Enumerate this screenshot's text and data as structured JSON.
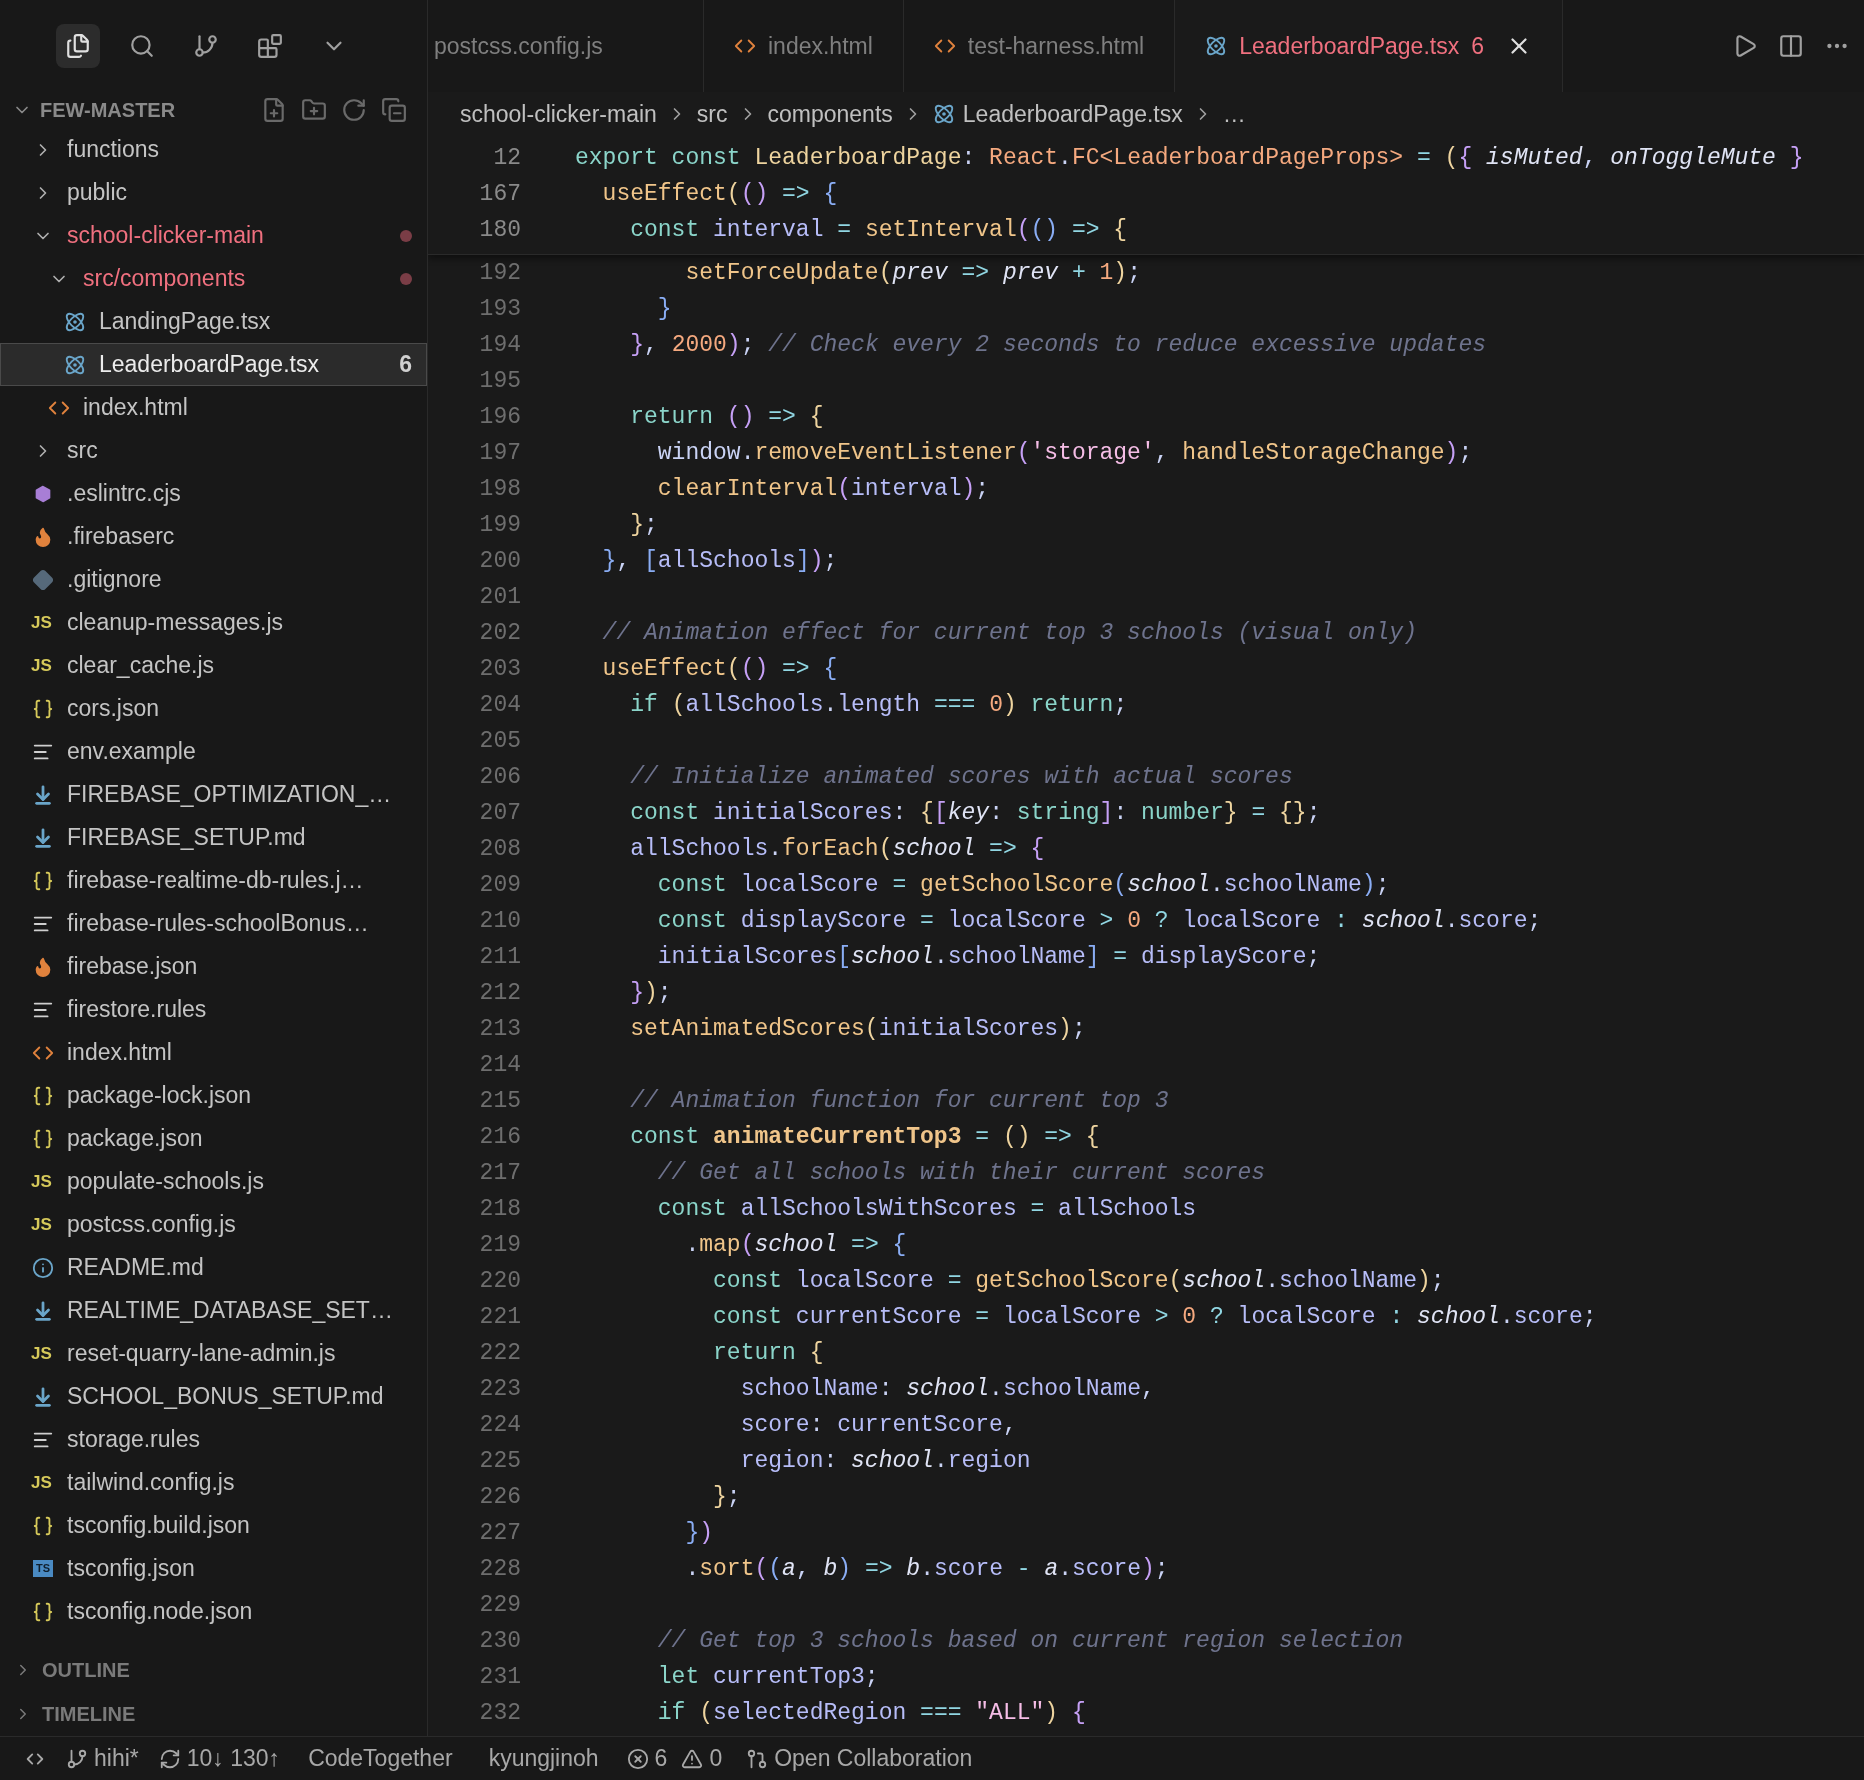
{
  "activity_bar": [
    {
      "kind": "explorer",
      "selected": true
    },
    {
      "kind": "search",
      "selected": false
    },
    {
      "kind": "source-control",
      "selected": false
    },
    {
      "kind": "extensions",
      "selected": false
    },
    {
      "kind": "more",
      "selected": false
    }
  ],
  "tabs": [
    {
      "label": "postcss.config.js",
      "selected": false
    },
    {
      "label": "index.html",
      "kind": "html",
      "selected": false
    },
    {
      "label": "test-harness.html",
      "kind": "html",
      "selected": false
    },
    {
      "label": "LeaderboardPage.tsx",
      "kind": "react",
      "selected": true,
      "badge": "6",
      "errors": true
    }
  ],
  "explorer": {
    "title": "FEW-MASTER",
    "expanded": true,
    "items": [
      {
        "label": "functions",
        "kind": "folder",
        "expanded": false
      },
      {
        "label": "public",
        "kind": "folder",
        "expanded": false
      },
      {
        "label": "school-clicker-main",
        "kind": "folder",
        "expanded": true,
        "modified": true,
        "children": [
          {
            "label": "src/components",
            "kind": "folder",
            "expanded": true,
            "modified": true,
            "children": [
              {
                "label": "LandingPage.tsx",
                "kind": "react",
                "selected": false
              },
              {
                "label": "LeaderboardPage.tsx",
                "kind": "react",
                "selected": true,
                "badge": "6"
              }
            ]
          },
          {
            "label": "index.html",
            "kind": "html",
            "selected": false
          }
        ]
      },
      {
        "label": "src",
        "kind": "folder",
        "expanded": false
      },
      {
        "label": ".eslintrc.cjs",
        "kind": "eslint",
        "selected": false
      },
      {
        "label": ".firebaserc",
        "kind": "firebase",
        "selected": false
      },
      {
        "label": ".gitignore",
        "kind": "git",
        "selected": false
      },
      {
        "label": "cleanup-messages.js",
        "kind": "js",
        "icon_label": "JS",
        "selected": false
      },
      {
        "label": "clear_cache.js",
        "kind": "js",
        "icon_label": "JS",
        "selected": false
      },
      {
        "label": "cors.json",
        "kind": "json",
        "selected": false
      },
      {
        "label": "env.example",
        "kind": "text",
        "selected": false
      },
      {
        "label": "FIREBASE_OPTIMIZATION_…",
        "kind": "markdown",
        "selected": false
      },
      {
        "label": "FIREBASE_SETUP.md",
        "kind": "markdown",
        "selected": false
      },
      {
        "label": "firebase-realtime-db-rules.j…",
        "kind": "json",
        "selected": false
      },
      {
        "label": "firebase-rules-schoolBonus…",
        "kind": "text",
        "selected": false
      },
      {
        "label": "firebase.json",
        "kind": "firebase",
        "selected": false
      },
      {
        "label": "firestore.rules",
        "kind": "text",
        "selected": false
      },
      {
        "label": "index.html",
        "kind": "html",
        "selected": false
      },
      {
        "label": "package-lock.json",
        "kind": "json",
        "selected": false
      },
      {
        "label": "package.json",
        "kind": "json",
        "selected": false
      },
      {
        "label": "populate-schools.js",
        "kind": "js",
        "icon_label": "JS",
        "selected": false
      },
      {
        "label": "postcss.config.js",
        "kind": "js",
        "icon_label": "JS",
        "selected": false
      },
      {
        "label": "README.md",
        "kind": "info",
        "selected": false
      },
      {
        "label": "REALTIME_DATABASE_SET…",
        "kind": "markdown",
        "selected": false
      },
      {
        "label": "reset-quarry-lane-admin.js",
        "kind": "js",
        "icon_label": "JS",
        "selected": false
      },
      {
        "label": "SCHOOL_BONUS_SETUP.md",
        "kind": "markdown",
        "selected": false
      },
      {
        "label": "storage.rules",
        "kind": "text",
        "selected": false
      },
      {
        "label": "tailwind.config.js",
        "kind": "js",
        "icon_label": "JS",
        "selected": false
      },
      {
        "label": "tsconfig.build.json",
        "kind": "json",
        "selected": false
      },
      {
        "label": "tsconfig.json",
        "kind": "ts",
        "icon_label": "TS",
        "selected": false
      },
      {
        "label": "tsconfig.node.json",
        "kind": "json",
        "selected": false
      }
    ]
  },
  "panels": [
    {
      "label": "OUTLINE",
      "expanded": false
    },
    {
      "label": "TIMELINE",
      "expanded": false
    }
  ],
  "breadcrumb": [
    {
      "label": "school-clicker-main"
    },
    {
      "label": "src"
    },
    {
      "label": "components"
    },
    {
      "label": "LeaderboardPage.tsx",
      "kind": "react"
    },
    {
      "label": "…"
    }
  ],
  "sticky_lines": [
    {
      "number": "12",
      "tokens": [
        {
          "kind": "kw",
          "text": "export const "
        },
        {
          "kind": "type",
          "text": "LeaderboardPage"
        },
        {
          "kind": "plain",
          "text": ": "
        },
        {
          "kind": "type2",
          "text": "React"
        },
        {
          "kind": "plain",
          "text": "."
        },
        {
          "kind": "type2",
          "text": "FC<LeaderboardPageProps>"
        },
        {
          "kind": "op",
          "text": " = "
        },
        {
          "kind": "b1",
          "text": "("
        },
        {
          "kind": "b2",
          "text": "{ "
        },
        {
          "kind": "param",
          "text": "isMuted"
        },
        {
          "kind": "plain",
          "text": ", "
        },
        {
          "kind": "param",
          "text": "onToggleMute"
        },
        {
          "kind": "b2",
          "text": " }"
        }
      ]
    },
    {
      "number": "167",
      "tokens": [
        {
          "kind": "fn",
          "text": "  useEffect"
        },
        {
          "kind": "b1",
          "text": "("
        },
        {
          "kind": "b2",
          "text": "()"
        },
        {
          "kind": "op",
          "text": " => "
        },
        {
          "kind": "b3",
          "text": "{"
        }
      ]
    },
    {
      "number": "180",
      "tokens": [
        {
          "kind": "kw",
          "text": "    const "
        },
        {
          "kind": "var",
          "text": "interval"
        },
        {
          "kind": "op",
          "text": " = "
        },
        {
          "kind": "fn",
          "text": "setInterval"
        },
        {
          "kind": "b2",
          "text": "("
        },
        {
          "kind": "b3",
          "text": "()"
        },
        {
          "kind": "op",
          "text": " => "
        },
        {
          "kind": "b1",
          "text": "{"
        }
      ]
    }
  ],
  "code_lines": [
    {
      "number": "192",
      "tokens": [
        {
          "kind": "fn",
          "text": "        setForceUpdate"
        },
        {
          "kind": "b1",
          "text": "("
        },
        {
          "kind": "param",
          "text": "prev"
        },
        {
          "kind": "op",
          "text": " => "
        },
        {
          "kind": "param",
          "text": "prev"
        },
        {
          "kind": "op",
          "text": " + "
        },
        {
          "kind": "num",
          "text": "1"
        },
        {
          "kind": "b1",
          "text": ")"
        },
        {
          "kind": "plain",
          "text": ";"
        }
      ]
    },
    {
      "number": "193",
      "tokens": [
        {
          "kind": "b3",
          "text": "      }"
        }
      ]
    },
    {
      "number": "194",
      "tokens": [
        {
          "kind": "b2",
          "text": "    }"
        },
        {
          "kind": "plain",
          "text": ", "
        },
        {
          "kind": "num",
          "text": "2000"
        },
        {
          "kind": "b2",
          "text": ")"
        },
        {
          "kind": "plain",
          "text": "; "
        },
        {
          "kind": "cm",
          "text": "// Check every 2 seconds to reduce excessive updates"
        }
      ]
    },
    {
      "number": "195"
    },
    {
      "number": "196",
      "tokens": [
        {
          "kind": "kw",
          "text": "    return "
        },
        {
          "kind": "b2",
          "text": "()"
        },
        {
          "kind": "op",
          "text": " => "
        },
        {
          "kind": "b1",
          "text": "{"
        }
      ]
    },
    {
      "number": "197",
      "tokens": [
        {
          "kind": "plain",
          "text": "      window."
        },
        {
          "kind": "fn",
          "text": "removeEventListener"
        },
        {
          "kind": "b2",
          "text": "("
        },
        {
          "kind": "str",
          "text": "'storage'"
        },
        {
          "kind": "plain",
          "text": ", "
        },
        {
          "kind": "fn",
          "text": "handleStorageChange"
        },
        {
          "kind": "b2",
          "text": ")"
        },
        {
          "kind": "plain",
          "text": ";"
        }
      ]
    },
    {
      "number": "198",
      "tokens": [
        {
          "kind": "fn",
          "text": "      clearInterval"
        },
        {
          "kind": "b2",
          "text": "("
        },
        {
          "kind": "var",
          "text": "interval"
        },
        {
          "kind": "b2",
          "text": ")"
        },
        {
          "kind": "plain",
          "text": ";"
        }
      ]
    },
    {
      "number": "199",
      "tokens": [
        {
          "kind": "b1",
          "text": "    }"
        },
        {
          "kind": "plain",
          "text": ";"
        }
      ]
    },
    {
      "number": "200",
      "tokens": [
        {
          "kind": "b3",
          "text": "  }"
        },
        {
          "kind": "plain",
          "text": ", "
        },
        {
          "kind": "b3",
          "text": "["
        },
        {
          "kind": "var",
          "text": "allSchools"
        },
        {
          "kind": "b3",
          "text": "]"
        },
        {
          "kind": "b2",
          "text": ")"
        },
        {
          "kind": "plain",
          "text": ";"
        }
      ]
    },
    {
      "number": "201"
    },
    {
      "number": "202",
      "tokens": [
        {
          "kind": "cm",
          "text": "  // Animation effect for current top 3 schools (visual only)"
        }
      ]
    },
    {
      "number": "203",
      "tokens": [
        {
          "kind": "fn",
          "text": "  useEffect"
        },
        {
          "kind": "b1",
          "text": "("
        },
        {
          "kind": "b2",
          "text": "()"
        },
        {
          "kind": "op",
          "text": " => "
        },
        {
          "kind": "b3",
          "text": "{"
        }
      ]
    },
    {
      "number": "204",
      "tokens": [
        {
          "kind": "kw",
          "text": "    if "
        },
        {
          "kind": "b1",
          "text": "("
        },
        {
          "kind": "var",
          "text": "allSchools"
        },
        {
          "kind": "plain",
          "text": "."
        },
        {
          "kind": "prop",
          "text": "length"
        },
        {
          "kind": "op",
          "text": " === "
        },
        {
          "kind": "num",
          "text": "0"
        },
        {
          "kind": "b1",
          "text": ")"
        },
        {
          "kind": "kw",
          "text": " return"
        },
        {
          "kind": "plain",
          "text": ";"
        }
      ]
    },
    {
      "number": "205"
    },
    {
      "number": "206",
      "tokens": [
        {
          "kind": "cm",
          "text": "    // Initialize animated scores with actual scores"
        }
      ]
    },
    {
      "number": "207",
      "tokens": [
        {
          "kind": "kw",
          "text": "    const "
        },
        {
          "kind": "var",
          "text": "initialScores"
        },
        {
          "kind": "plain",
          "text": ": "
        },
        {
          "kind": "b1",
          "text": "{"
        },
        {
          "kind": "b2",
          "text": "["
        },
        {
          "kind": "param",
          "text": "key"
        },
        {
          "kind": "plain",
          "text": ": "
        },
        {
          "kind": "kw",
          "text": "string"
        },
        {
          "kind": "b2",
          "text": "]"
        },
        {
          "kind": "plain",
          "text": ": "
        },
        {
          "kind": "kw",
          "text": "number"
        },
        {
          "kind": "b1",
          "text": "}"
        },
        {
          "kind": "op",
          "text": " = "
        },
        {
          "kind": "b1",
          "text": "{}"
        },
        {
          "kind": "plain",
          "text": ";"
        }
      ]
    },
    {
      "number": "208",
      "tokens": [
        {
          "kind": "var",
          "text": "    allSchools"
        },
        {
          "kind": "plain",
          "text": "."
        },
        {
          "kind": "fn",
          "text": "forEach"
        },
        {
          "kind": "b1",
          "text": "("
        },
        {
          "kind": "param",
          "text": "school"
        },
        {
          "kind": "op",
          "text": " => "
        },
        {
          "kind": "b2",
          "text": "{"
        }
      ]
    },
    {
      "number": "209",
      "tokens": [
        {
          "kind": "kw",
          "text": "      const "
        },
        {
          "kind": "var",
          "text": "localScore"
        },
        {
          "kind": "op",
          "text": " = "
        },
        {
          "kind": "fn",
          "text": "getSchoolScore"
        },
        {
          "kind": "b3",
          "text": "("
        },
        {
          "kind": "param",
          "text": "school"
        },
        {
          "kind": "plain",
          "text": "."
        },
        {
          "kind": "prop",
          "text": "schoolName"
        },
        {
          "kind": "b3",
          "text": ")"
        },
        {
          "kind": "plain",
          "text": ";"
        }
      ]
    },
    {
      "number": "210",
      "tokens": [
        {
          "kind": "kw",
          "text": "      const "
        },
        {
          "kind": "var",
          "text": "displayScore"
        },
        {
          "kind": "op",
          "text": " = "
        },
        {
          "kind": "var",
          "text": "localScore"
        },
        {
          "kind": "op",
          "text": " > "
        },
        {
          "kind": "num",
          "text": "0"
        },
        {
          "kind": "op",
          "text": " ? "
        },
        {
          "kind": "var",
          "text": "localScore"
        },
        {
          "kind": "op",
          "text": " : "
        },
        {
          "kind": "param",
          "text": "school"
        },
        {
          "kind": "plain",
          "text": "."
        },
        {
          "kind": "prop",
          "text": "score"
        },
        {
          "kind": "plain",
          "text": ";"
        }
      ]
    },
    {
      "number": "211",
      "tokens": [
        {
          "kind": "var",
          "text": "      initialScores"
        },
        {
          "kind": "b3",
          "text": "["
        },
        {
          "kind": "param",
          "text": "school"
        },
        {
          "kind": "plain",
          "text": "."
        },
        {
          "kind": "prop",
          "text": "schoolName"
        },
        {
          "kind": "b3",
          "text": "]"
        },
        {
          "kind": "op",
          "text": " = "
        },
        {
          "kind": "var",
          "text": "displayScore"
        },
        {
          "kind": "plain",
          "text": ";"
        }
      ]
    },
    {
      "number": "212",
      "tokens": [
        {
          "kind": "b2",
          "text": "    }"
        },
        {
          "kind": "b1",
          "text": ")"
        },
        {
          "kind": "plain",
          "text": ";"
        }
      ]
    },
    {
      "number": "213",
      "tokens": [
        {
          "kind": "fn",
          "text": "    setAnimatedScores"
        },
        {
          "kind": "b1",
          "text": "("
        },
        {
          "kind": "var",
          "text": "initialScores"
        },
        {
          "kind": "b1",
          "text": ")"
        },
        {
          "kind": "plain",
          "text": ";"
        }
      ]
    },
    {
      "number": "214"
    },
    {
      "number": "215",
      "tokens": [
        {
          "kind": "cm",
          "text": "    // Animation function for current top 3"
        }
      ]
    },
    {
      "number": "216",
      "tokens": [
        {
          "kind": "kw",
          "text": "    const "
        },
        {
          "kind": "fnbold",
          "text": "animateCurrentTop3"
        },
        {
          "kind": "op",
          "text": " = "
        },
        {
          "kind": "b1",
          "text": "()"
        },
        {
          "kind": "op",
          "text": " => "
        },
        {
          "kind": "b1",
          "text": "{"
        }
      ]
    },
    {
      "number": "217",
      "tokens": [
        {
          "kind": "cm",
          "text": "      // Get all schools with their current scores"
        }
      ]
    },
    {
      "number": "218",
      "tokens": [
        {
          "kind": "kw",
          "text": "      const "
        },
        {
          "kind": "var",
          "text": "allSchoolsWithScores"
        },
        {
          "kind": "op",
          "text": " = "
        },
        {
          "kind": "var",
          "text": "allSchools"
        }
      ]
    },
    {
      "number": "219",
      "tokens": [
        {
          "kind": "plain",
          "text": "        ."
        },
        {
          "kind": "fn",
          "text": "map"
        },
        {
          "kind": "b2",
          "text": "("
        },
        {
          "kind": "param",
          "text": "school"
        },
        {
          "kind": "op",
          "text": " => "
        },
        {
          "kind": "b3",
          "text": "{"
        }
      ]
    },
    {
      "number": "220",
      "tokens": [
        {
          "kind": "kw",
          "text": "          const "
        },
        {
          "kind": "var",
          "text": "localScore"
        },
        {
          "kind": "op",
          "text": " = "
        },
        {
          "kind": "fn",
          "text": "getSchoolScore"
        },
        {
          "kind": "b1",
          "text": "("
        },
        {
          "kind": "param",
          "text": "school"
        },
        {
          "kind": "plain",
          "text": "."
        },
        {
          "kind": "prop",
          "text": "schoolName"
        },
        {
          "kind": "b1",
          "text": ")"
        },
        {
          "kind": "plain",
          "text": ";"
        }
      ]
    },
    {
      "number": "221",
      "tokens": [
        {
          "kind": "kw",
          "text": "          const "
        },
        {
          "kind": "var",
          "text": "currentScore"
        },
        {
          "kind": "op",
          "text": " = "
        },
        {
          "kind": "var",
          "text": "localScore"
        },
        {
          "kind": "op",
          "text": " > "
        },
        {
          "kind": "num",
          "text": "0"
        },
        {
          "kind": "op",
          "text": " ? "
        },
        {
          "kind": "var",
          "text": "localScore"
        },
        {
          "kind": "op",
          "text": " : "
        },
        {
          "kind": "param",
          "text": "school"
        },
        {
          "kind": "plain",
          "text": "."
        },
        {
          "kind": "prop",
          "text": "score"
        },
        {
          "kind": "plain",
          "text": ";"
        }
      ]
    },
    {
      "number": "222",
      "tokens": [
        {
          "kind": "kw",
          "text": "          return "
        },
        {
          "kind": "b1",
          "text": "{"
        }
      ]
    },
    {
      "number": "223",
      "tokens": [
        {
          "kind": "prop",
          "text": "            schoolName"
        },
        {
          "kind": "plain",
          "text": ": "
        },
        {
          "kind": "param",
          "text": "school"
        },
        {
          "kind": "plain",
          "text": "."
        },
        {
          "kind": "prop",
          "text": "schoolName"
        },
        {
          "kind": "plain",
          "text": ","
        }
      ]
    },
    {
      "number": "224",
      "tokens": [
        {
          "kind": "prop",
          "text": "            score"
        },
        {
          "kind": "plain",
          "text": ": "
        },
        {
          "kind": "var",
          "text": "currentScore"
        },
        {
          "kind": "plain",
          "text": ","
        }
      ]
    },
    {
      "number": "225",
      "tokens": [
        {
          "kind": "prop",
          "text": "            region"
        },
        {
          "kind": "plain",
          "text": ": "
        },
        {
          "kind": "param",
          "text": "school"
        },
        {
          "kind": "plain",
          "text": "."
        },
        {
          "kind": "prop",
          "text": "region"
        }
      ]
    },
    {
      "number": "226",
      "tokens": [
        {
          "kind": "b1",
          "text": "          }"
        },
        {
          "kind": "plain",
          "text": ";"
        }
      ]
    },
    {
      "number": "227",
      "tokens": [
        {
          "kind": "b3",
          "text": "        }"
        },
        {
          "kind": "b2",
          "text": ")"
        }
      ]
    },
    {
      "number": "228",
      "tokens": [
        {
          "kind": "plain",
          "text": "        ."
        },
        {
          "kind": "fn",
          "text": "sort"
        },
        {
          "kind": "b2",
          "text": "("
        },
        {
          "kind": "b3",
          "text": "("
        },
        {
          "kind": "param",
          "text": "a"
        },
        {
          "kind": "plain",
          "text": ", "
        },
        {
          "kind": "param",
          "text": "b"
        },
        {
          "kind": "b3",
          "text": ")"
        },
        {
          "kind": "op",
          "text": " => "
        },
        {
          "kind": "param",
          "text": "b"
        },
        {
          "kind": "plain",
          "text": "."
        },
        {
          "kind": "prop",
          "text": "score"
        },
        {
          "kind": "op",
          "text": " - "
        },
        {
          "kind": "param",
          "text": "a"
        },
        {
          "kind": "plain",
          "text": "."
        },
        {
          "kind": "prop",
          "text": "score"
        },
        {
          "kind": "b2",
          "text": ")"
        },
        {
          "kind": "plain",
          "text": ";"
        }
      ]
    },
    {
      "number": "229"
    },
    {
      "number": "230",
      "tokens": [
        {
          "kind": "cm",
          "text": "      // Get top 3 schools based on current region selection"
        }
      ]
    },
    {
      "number": "231",
      "tokens": [
        {
          "kind": "kw",
          "text": "      let "
        },
        {
          "kind": "var",
          "text": "currentTop3"
        },
        {
          "kind": "plain",
          "text": ";"
        }
      ]
    },
    {
      "number": "232",
      "tokens": [
        {
          "kind": "kw",
          "text": "      if "
        },
        {
          "kind": "b1",
          "text": "("
        },
        {
          "kind": "var",
          "text": "selectedRegion"
        },
        {
          "kind": "op",
          "text": " === "
        },
        {
          "kind": "str",
          "text": "\"ALL\""
        },
        {
          "kind": "b1",
          "text": ")"
        },
        {
          "kind": "b2",
          "text": " {"
        }
      ]
    }
  ],
  "status_bar": [
    {
      "kind": "remote"
    },
    {
      "kind": "branch",
      "text": "hihi*"
    },
    {
      "kind": "sync",
      "text": "10↓ 130↑"
    },
    {
      "kind": "plain",
      "text": "CodeTogether"
    },
    {
      "kind": "plain",
      "text": "kyungjinoh"
    },
    {
      "kind": "errors",
      "text": "6"
    },
    {
      "kind": "warnings",
      "text": "0"
    },
    {
      "kind": "collab",
      "text": "Open Collaboration"
    }
  ]
}
